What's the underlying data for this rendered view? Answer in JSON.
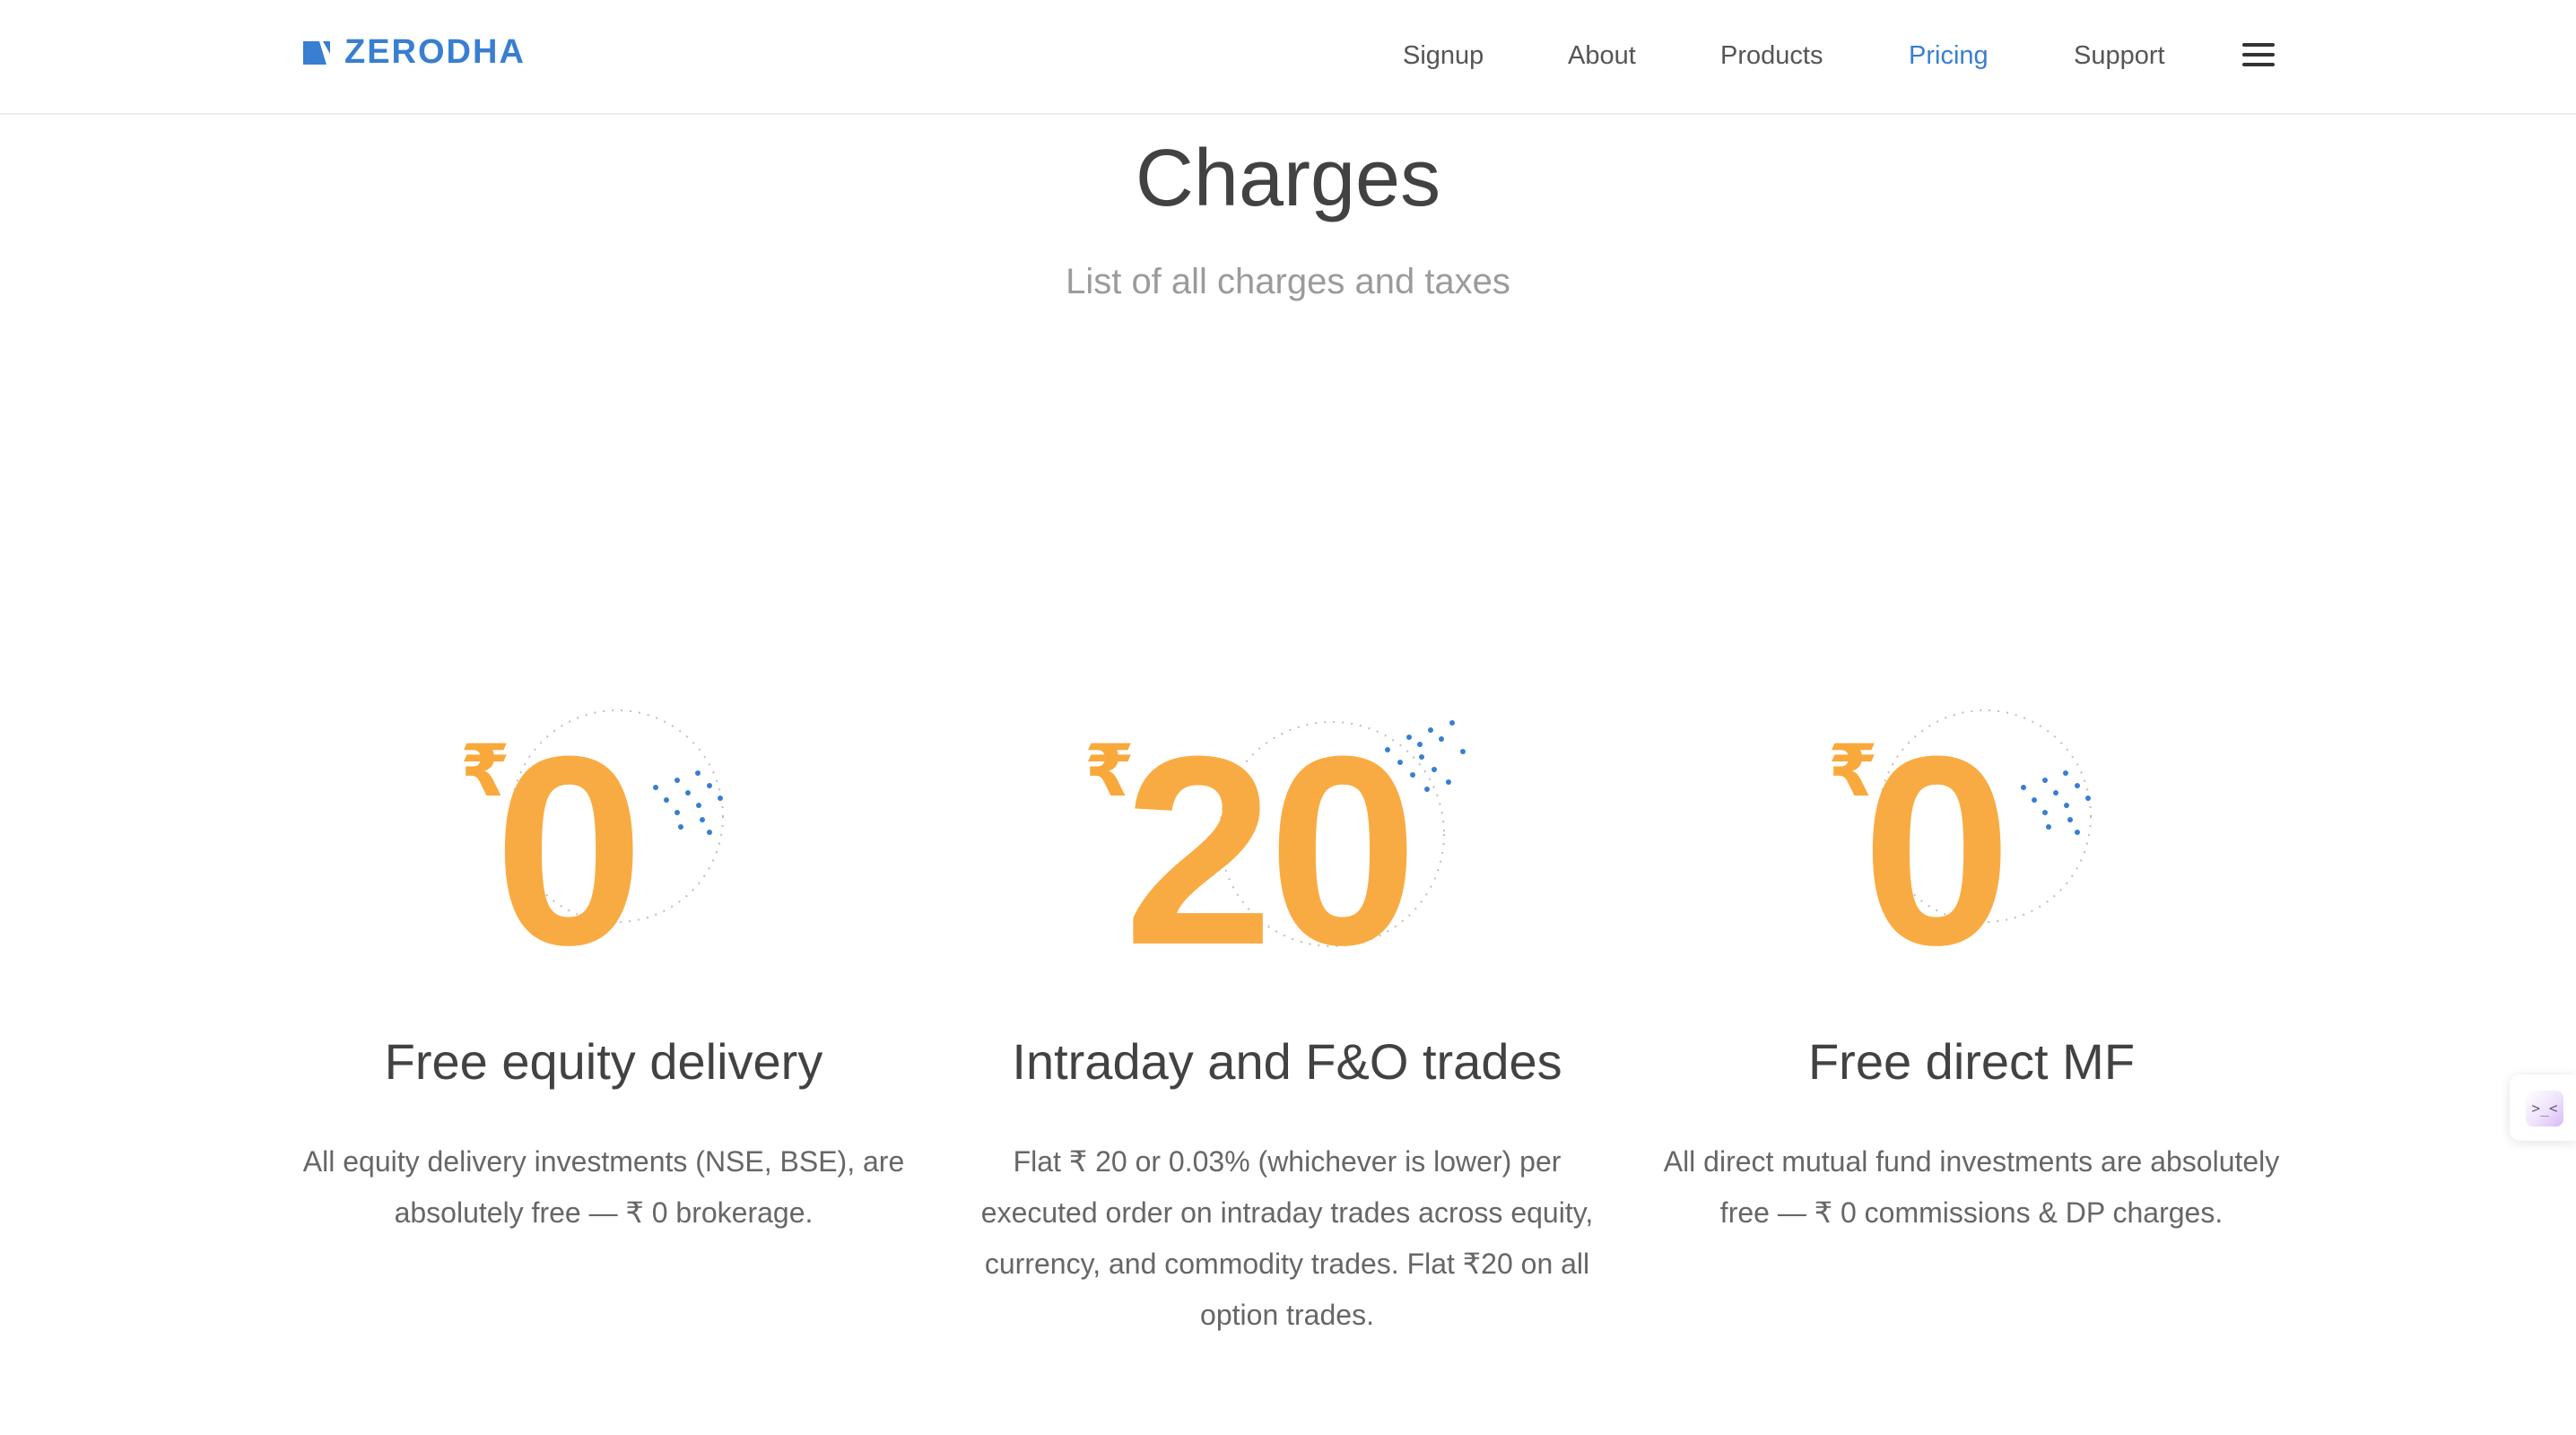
{
  "brand": {
    "name": "ZERODHA",
    "color": "#387ed1"
  },
  "nav": {
    "links": [
      {
        "label": "Signup"
      },
      {
        "label": "About"
      },
      {
        "label": "Products"
      },
      {
        "label": "Pricing",
        "active": true
      },
      {
        "label": "Support"
      }
    ],
    "menu_icon": "hamburger-menu-icon"
  },
  "hero": {
    "title": "Charges",
    "subtitle": "List of all charges and taxes"
  },
  "cards": [
    {
      "currency_symbol": "₹",
      "price": "0",
      "title": "Free equity delivery",
      "description": "All equity delivery investments (NSE, BSE), are absolutely free — ₹ 0 brokerage."
    },
    {
      "currency_symbol": "₹",
      "price": "20",
      "title": "Intraday and F&O trades",
      "description": "Flat ₹ 20 or 0.03% (whichever is lower) per executed order on intraday trades across equity, currency, and commodity trades. Flat ₹20 on all option trades."
    },
    {
      "currency_symbol": "₹",
      "price": "0",
      "title": "Free direct MF",
      "description": "All direct mutual fund investments are absolutely free — ₹ 0 commissions & DP charges."
    }
  ],
  "colors": {
    "price_accent": "#f9ab43",
    "dot_accent": "#387ed1",
    "text_primary": "#424242",
    "text_muted": "#9b9b9b"
  },
  "widget": {
    "icon": "chat-widget-icon",
    "glyph": ">_<"
  }
}
